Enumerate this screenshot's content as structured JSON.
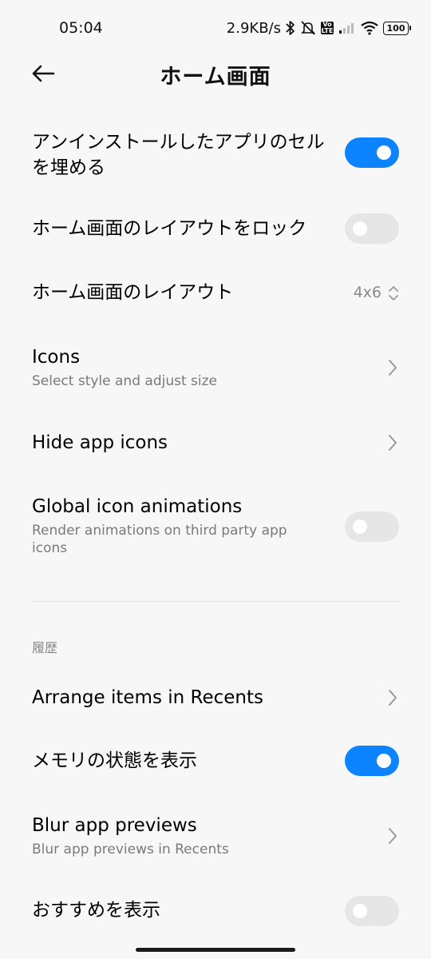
{
  "status_bar": {
    "time": "05:04",
    "net_speed": "2.9KB/s",
    "volte_label": "Vo LTE",
    "battery": "100"
  },
  "header": {
    "title": "ホーム画面"
  },
  "settings": {
    "fill_cells": {
      "title": "アンインストールしたアプリのセルを埋める",
      "enabled": true
    },
    "lock_layout": {
      "title": "ホーム画面のレイアウトをロック",
      "enabled": false
    },
    "layout": {
      "title": "ホーム画面のレイアウト",
      "value": "4x6"
    },
    "icons": {
      "title": "Icons",
      "subtitle": "Select style and adjust size"
    },
    "hide_icons": {
      "title": "Hide app icons"
    },
    "global_anim": {
      "title": "Global icon animations",
      "subtitle": "Render animations on third party app icons",
      "enabled": false
    }
  },
  "recents_section": {
    "label": "履歴",
    "arrange": {
      "title": "Arrange items in Recents"
    },
    "memory": {
      "title": "メモリの状態を表示",
      "enabled": true
    },
    "blur": {
      "title": "Blur app previews",
      "subtitle": "Blur app previews in Recents"
    },
    "suggestions": {
      "title": "おすすめを表示",
      "enabled": false
    }
  },
  "colors": {
    "accent": "#0d84ff",
    "toggle_off": "#e6e6e6",
    "background": "#f7f7f7"
  }
}
